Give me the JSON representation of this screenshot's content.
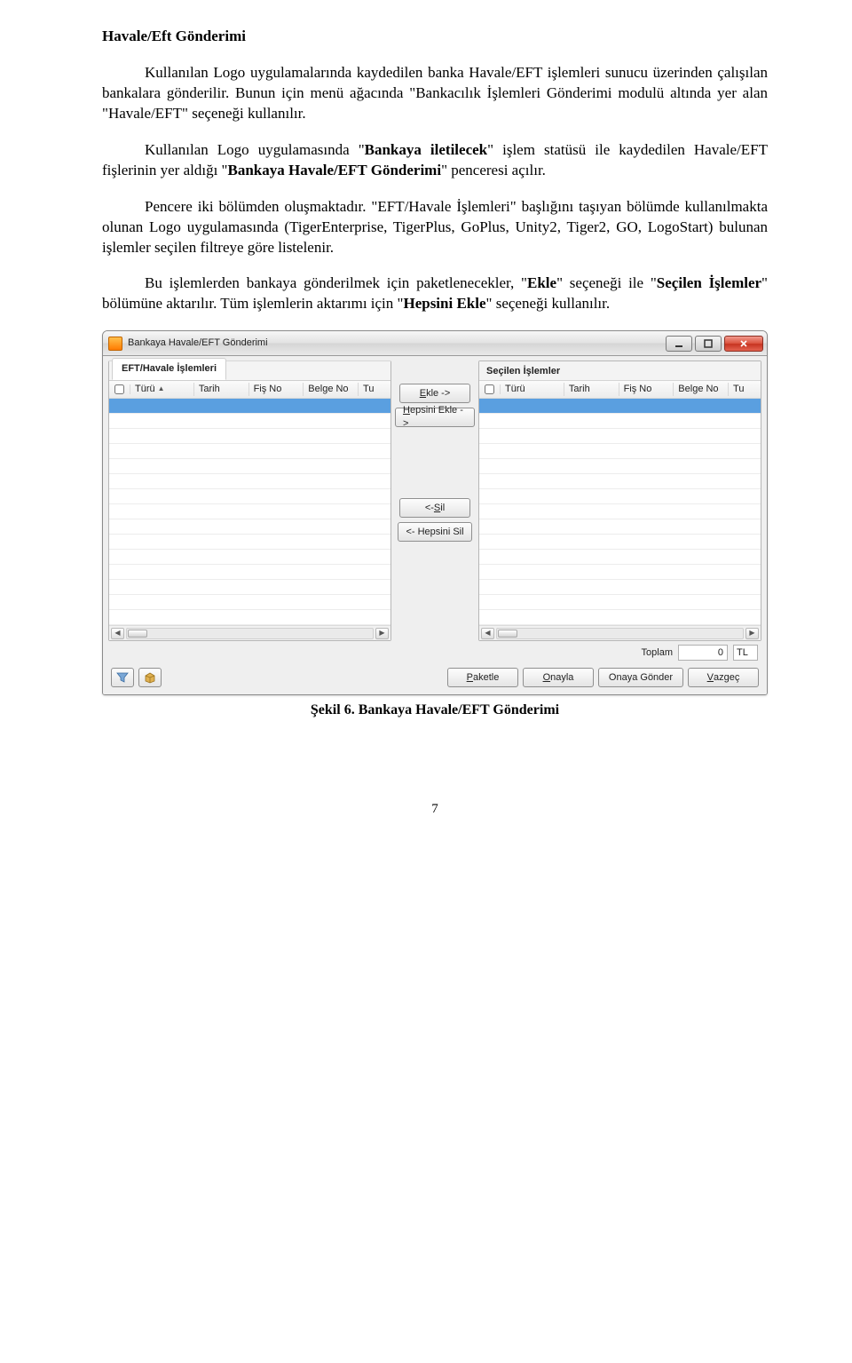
{
  "heading": "Havale/Eft Gönderimi",
  "p1": "Kullanılan Logo uygulamalarında kaydedilen banka Havale/EFT işlemleri sunucu üzerinden çalışılan bankalara gönderilir. Bunun için menü ağacında \"Bankacılık İşlemleri Gönderimi modulü altında yer alan \"Havale/EFT\" seçeneği kullanılır.",
  "p2_a": "Kullanılan Logo uygulamasında \"",
  "p2_b1": "Bankaya iletilecek",
  "p2_c": "\" işlem statüsü ile kaydedilen Havale/EFT fişlerinin yer aldığı \"",
  "p2_b2": "Bankaya Havale/EFT Gönderimi",
  "p2_d": "\" penceresi açılır.",
  "p3": "Pencere iki bölümden oluşmaktadır. \"EFT/Havale İşlemleri\" başlığını taşıyan bölümde kullanılmakta olunan Logo uygulamasında (TigerEnterprise, TigerPlus, GoPlus, Unity2, Tiger2, GO, LogoStart) bulunan işlemler seçilen filtreye göre listelenir.",
  "p4_a": "Bu işlemlerden bankaya gönderilmek için paketlenecekler, \"",
  "p4_b1": "Ekle",
  "p4_c": "\" seçeneği ile \"",
  "p4_b2": "Seçilen İşlemler",
  "p4_d": "\" bölümüne aktarılır. Tüm işlemlerin aktarımı için \"",
  "p4_b3": "Hepsini Ekle",
  "p4_e": "\" seçeneği kullanılır.",
  "window": {
    "title": "Bankaya Havale/EFT Gönderimi",
    "left_tab": "EFT/Havale İşlemleri",
    "right_tab": "Seçilen İşlemler",
    "cols": {
      "turu": "Türü",
      "tarih": "Tarih",
      "fis": "Fiş No",
      "belge": "Belge No",
      "tu": "Tu"
    },
    "buttons": {
      "ekle": "Ekle ->",
      "hepsini_ekle": "Hepsini Ekle ->",
      "sil": "<- Sil",
      "hepsini_sil": "<- Hepsini Sil",
      "paketle": "Paketle",
      "onayla": "Onayla",
      "onaya_gonder": "Onaya Gönder",
      "vazgec": "Vazgeç"
    },
    "totals_label": "Toplam",
    "totals_value": "0",
    "totals_currency": "TL"
  },
  "caption_label": "Şekil 6. Bankaya Havale/EFT Gönderimi",
  "page_number": "7"
}
